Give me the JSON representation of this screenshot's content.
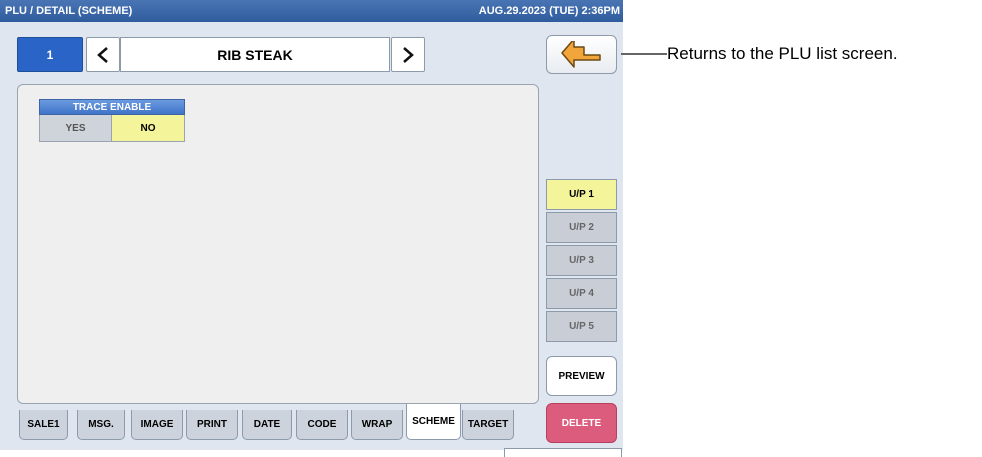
{
  "titlebar": {
    "title": "PLU / DETAIL (SCHEME)",
    "datetime": "AUG.29.2023 (TUE)  2:36PM"
  },
  "header": {
    "plu_number": "1",
    "item_name": "RIB STEAK",
    "prev_icon": "chevron-left-icon",
    "next_icon": "chevron-right-icon",
    "back_icon": "return-arrow-icon"
  },
  "trace": {
    "label": "TRACE ENABLE",
    "options": [
      "YES",
      "NO"
    ],
    "selected": "NO"
  },
  "unit_price_buttons": [
    {
      "label": "U/P 1",
      "active": true
    },
    {
      "label": "U/P 2",
      "active": false
    },
    {
      "label": "U/P 3",
      "active": false
    },
    {
      "label": "U/P 4",
      "active": false
    },
    {
      "label": "U/P 5",
      "active": false
    }
  ],
  "actions": {
    "preview": "PREVIEW",
    "delete": "DELETE"
  },
  "tabs": [
    {
      "label": "SALE1"
    },
    {
      "label": "MSG."
    },
    {
      "label": "IMAGE"
    },
    {
      "label": "PRINT"
    },
    {
      "label": "DATE"
    },
    {
      "label": "CODE"
    },
    {
      "label": "WRAP"
    },
    {
      "label": "SCHEME",
      "active": true
    },
    {
      "label": "TARGET"
    }
  ],
  "callout": {
    "text": "Returns to the PLU list screen."
  },
  "colors": {
    "accent": "#2a64c6",
    "selected": "#f4f49a",
    "delete": "#dc5c7e"
  }
}
